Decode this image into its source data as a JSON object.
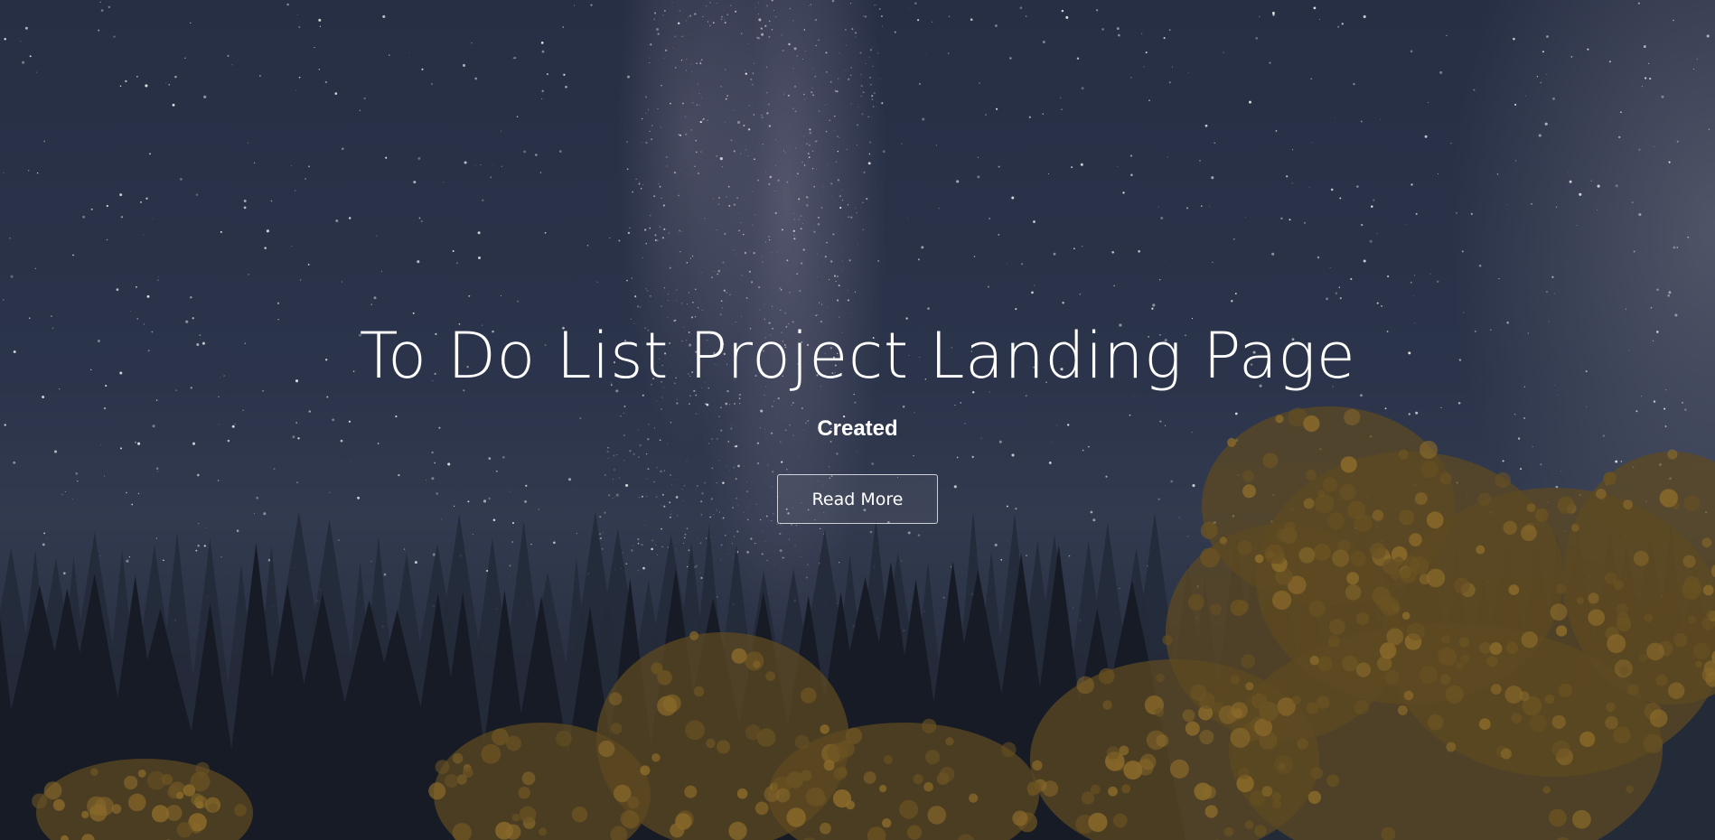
{
  "hero": {
    "title": "To Do List Project Landing Page",
    "subtitle": "Created",
    "button_label": "Read More",
    "background": "night-sky-milky-way-forest-image"
  },
  "colors": {
    "text": "#ffffff",
    "sky_top": "#272f45",
    "sky_bottom": "#1f2634",
    "tree_dark": "#161b25",
    "tree_autumn": "#6a5222"
  }
}
